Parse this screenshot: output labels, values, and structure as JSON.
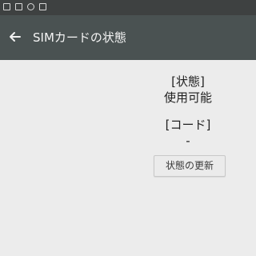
{
  "statusbar": {
    "icons": [
      "sim-icon",
      "dual-sim-icon",
      "cast-icon",
      "gallery-icon"
    ]
  },
  "appbar": {
    "back_icon": "arrow-left-icon",
    "title": "SIMカードの状態"
  },
  "sim_status": {
    "status_label": "[状態]",
    "status_value": "使用可能",
    "code_label": "[コード]",
    "code_value": "-",
    "refresh_button": "状態の更新"
  }
}
